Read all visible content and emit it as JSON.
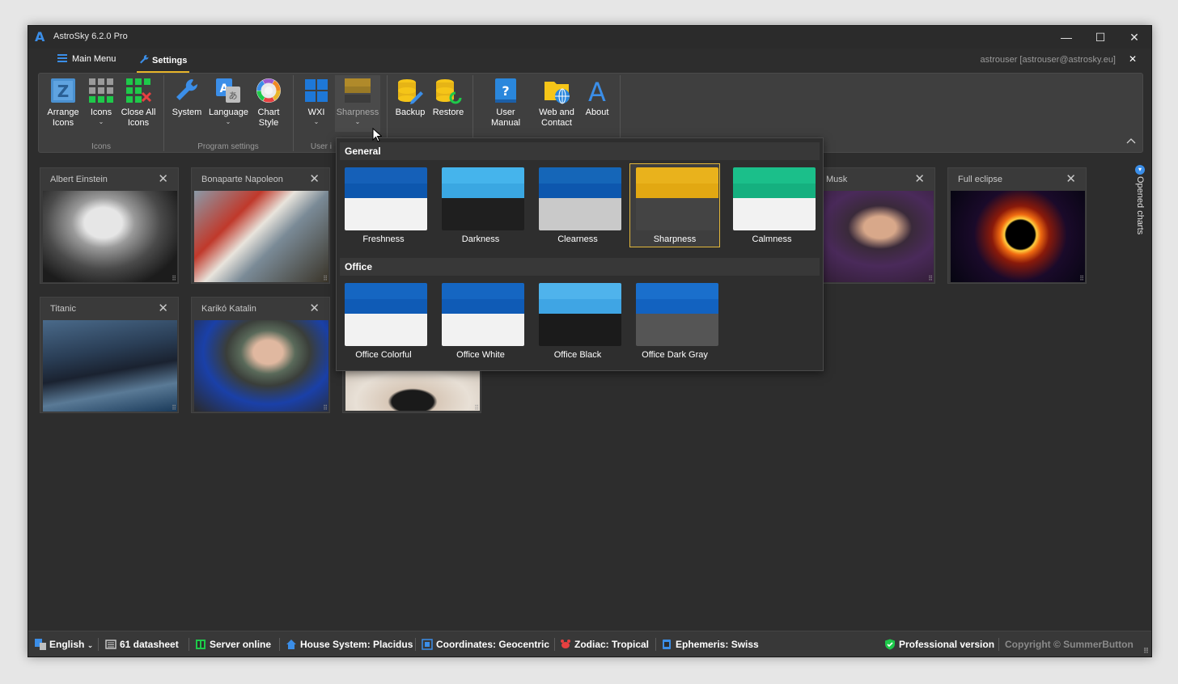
{
  "app": {
    "title": "AstroSky 6.2.0 Pro",
    "logo": "A"
  },
  "window_controls": {
    "minimize": "—",
    "maximize": "☐",
    "close": "✕"
  },
  "menubar": {
    "main_menu": "Main Menu",
    "settings": "Settings"
  },
  "user": {
    "label": "astrouser [astrouser@astrosky.eu]",
    "close": "✕"
  },
  "ribbon": {
    "buttons": [
      {
        "label": "Arrange Icons"
      },
      {
        "label": "Icons"
      },
      {
        "label": "Close All Icons"
      },
      {
        "label": "System"
      },
      {
        "label": "Language"
      },
      {
        "label": "Chart Style"
      },
      {
        "label": "WXI"
      },
      {
        "label": "Sharpness"
      },
      {
        "label": "Backup"
      },
      {
        "label": "Restore"
      },
      {
        "label": "User Manual"
      },
      {
        "label": "Web and Contact"
      },
      {
        "label": "About"
      }
    ],
    "groups": [
      "Icons",
      "Program settings",
      "User i"
    ],
    "collapse": "^"
  },
  "cards": [
    {
      "title": "Albert Einstein"
    },
    {
      "title": "Bonaparte Napoleon"
    },
    {
      "title": "Musk"
    },
    {
      "title": "Full eclipse"
    },
    {
      "title": "Titanic"
    },
    {
      "title": "Karikó Katalin"
    }
  ],
  "theme_dropdown": {
    "general_header": "General",
    "office_header": "Office",
    "general": [
      {
        "label": "Freshness",
        "colors": [
          "#1560b8",
          "#0d57ae",
          "#f2f2f2"
        ]
      },
      {
        "label": "Darkness",
        "colors": [
          "#45b4ec",
          "#3aa7e2",
          "#1f1f1f"
        ]
      },
      {
        "label": "Clearness",
        "colors": [
          "#1566b8",
          "#0d57ae",
          "#c9c9c9"
        ]
      },
      {
        "label": "Sharpness",
        "colors": [
          "#e9b21c",
          "#e2a812",
          "#444444"
        ],
        "selected": true
      },
      {
        "label": "Calmness",
        "colors": [
          "#1bbf8a",
          "#15b07f",
          "#f2f2f2"
        ]
      }
    ],
    "office": [
      {
        "label": "Office Colorful",
        "colors": [
          "#1566c2",
          "#0f5bb6",
          "#f2f2f2"
        ]
      },
      {
        "label": "Office White",
        "colors": [
          "#1566c2",
          "#0f5bb6",
          "#f2f2f2"
        ]
      },
      {
        "label": "Office Black",
        "colors": [
          "#4fb3ec",
          "#3fa5e4",
          "#1b1b1b"
        ]
      },
      {
        "label": "Office Dark Gray",
        "colors": [
          "#1a6fcc",
          "#1262c0",
          "#555555"
        ]
      }
    ]
  },
  "side_panel": {
    "label": "Opened charts"
  },
  "statusbar": {
    "language": "English",
    "datasheet": "61 datasheet",
    "server": "Server online",
    "house": "House System: Placidus",
    "coordinates": "Coordinates: Geocentric",
    "zodiac": "Zodiac: Tropical",
    "ephemeris": "Ephemeris: Swiss",
    "version": "Professional version",
    "copyright": "Copyright © SummerButton"
  }
}
